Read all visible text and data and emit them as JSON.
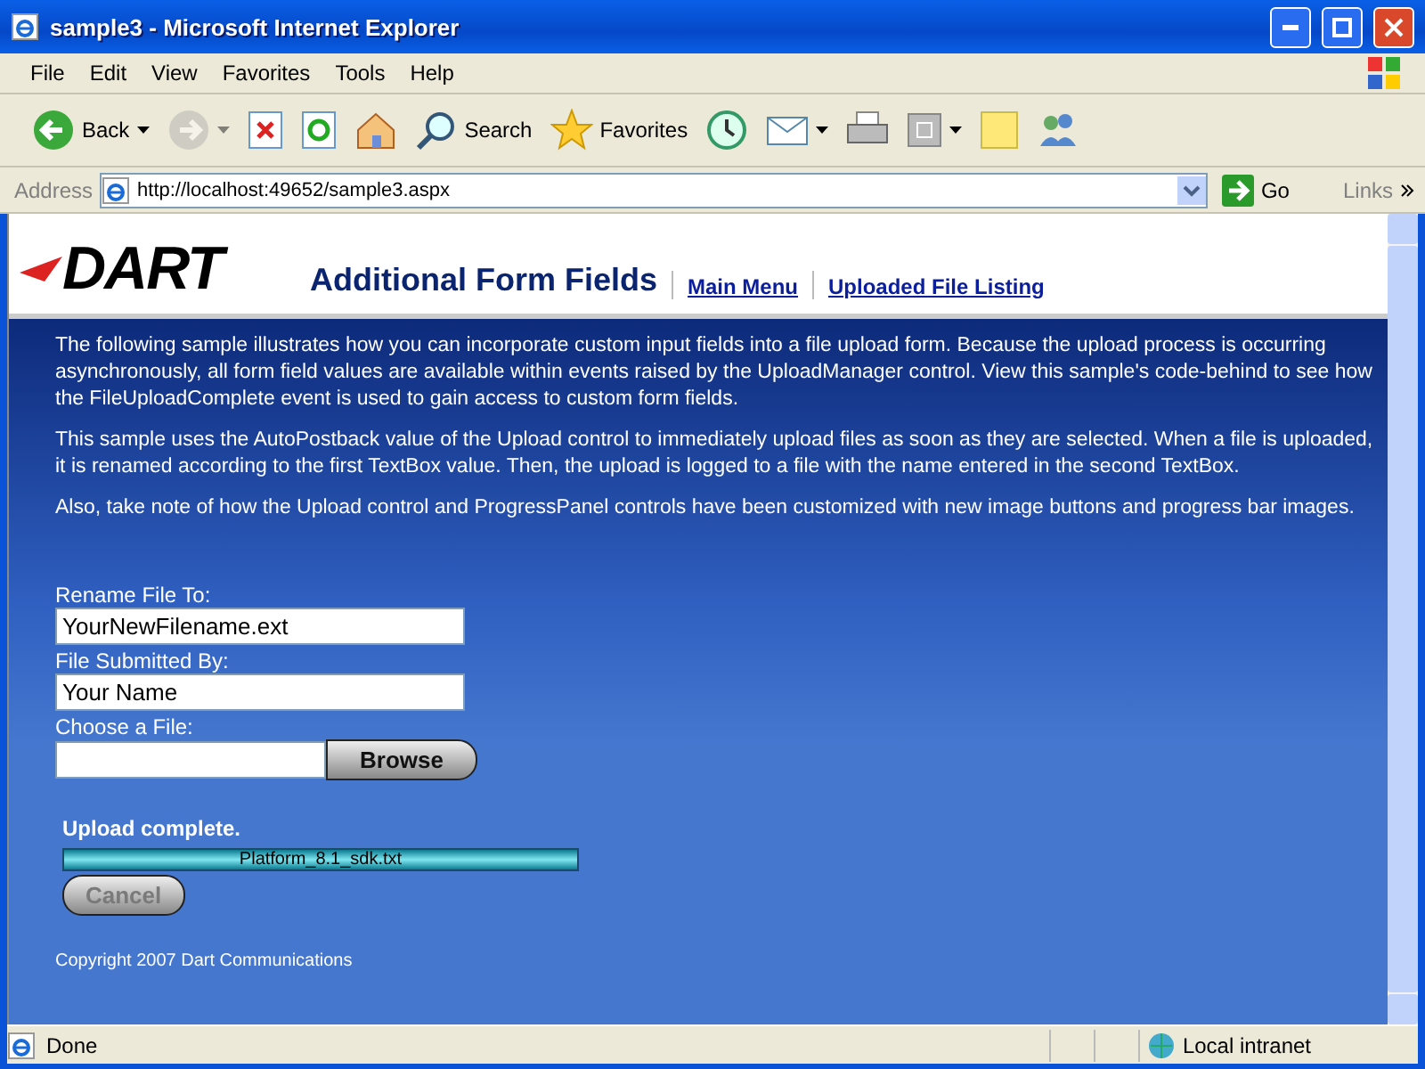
{
  "window": {
    "title": "sample3 - Microsoft Internet Explorer"
  },
  "menu": [
    "File",
    "Edit",
    "View",
    "Favorites",
    "Tools",
    "Help"
  ],
  "toolbar": [
    {
      "kind": "back",
      "label": "Back",
      "disabled": false
    },
    {
      "kind": "forward",
      "disabled": true
    },
    {
      "kind": "stop",
      "disabled": false
    },
    {
      "kind": "refresh",
      "disabled": false
    },
    {
      "kind": "home",
      "disabled": false
    },
    {
      "kind": "search",
      "label": "Search",
      "disabled": false
    },
    {
      "kind": "favorites",
      "label": "Favorites",
      "disabled": false
    },
    {
      "kind": "history",
      "disabled": false
    },
    {
      "kind": "mail",
      "disabled": false
    },
    {
      "kind": "print",
      "disabled": false
    },
    {
      "kind": "edit",
      "disabled": false
    },
    {
      "kind": "note",
      "disabled": false
    },
    {
      "kind": "messenger",
      "disabled": false
    }
  ],
  "address_bar": {
    "label": "Address",
    "url": "http://localhost:49652/sample3.aspx",
    "go": "Go",
    "links": "Links"
  },
  "page": {
    "logo": "DART",
    "heading": "Additional Form Fields",
    "links": [
      "Main Menu",
      "Uploaded File Listing"
    ],
    "paragraphs": [
      "The following sample illustrates how you can incorporate custom input fields into a file upload form. Because the upload process is occurring asynchronously, all form field values are available within events raised by the UploadManager control. View this sample's code-behind to see how the FileUploadComplete event is used to gain access to custom form fields.",
      "This sample uses the AutoPostback value of the Upload control to immediately upload files as soon as they are selected.  When a file is uploaded, it is renamed according to the first TextBox value.  Then, the upload is logged to a file with the name entered in the second TextBox.",
      "Also, take note of how the Upload control and ProgressPanel controls have been customized with new image buttons and progress bar images."
    ],
    "fields": [
      {
        "label": "Rename File To:",
        "value": "YourNewFilename.ext"
      },
      {
        "label": "File Submitted By:",
        "value": "Your Name"
      }
    ],
    "file_field": {
      "label": "Choose a File:",
      "button": "Browse"
    },
    "upload": {
      "status": "Upload complete.",
      "level": 1,
      "filename": "Platform_8.1_sdk.txt",
      "cancel": {
        "label": "Cancel",
        "disabled": true
      }
    },
    "copyright": "Copyright 2007  Dart Communications"
  },
  "status_bar": {
    "text": "Done",
    "zone": "Local intranet"
  }
}
